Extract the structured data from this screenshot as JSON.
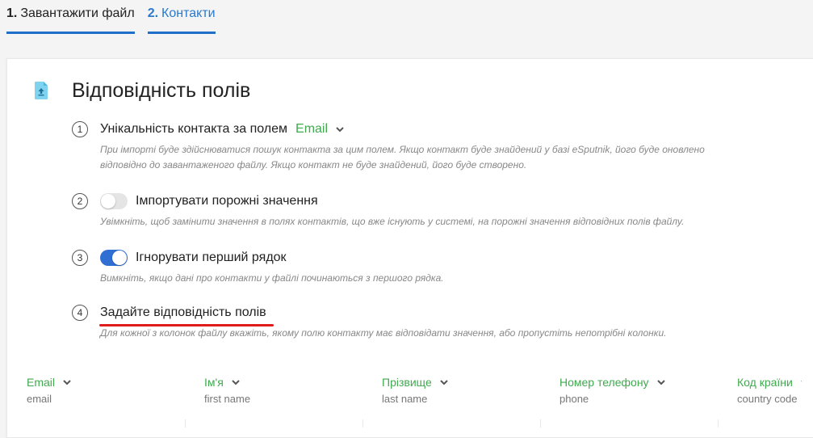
{
  "tabs": [
    {
      "num": "1.",
      "label": "Завантажити файл",
      "active": false
    },
    {
      "num": "2.",
      "label": "Контакти",
      "active": true
    }
  ],
  "card": {
    "title": "Відповідність полів",
    "icon": "document-upload-icon"
  },
  "steps": [
    {
      "num": "1",
      "title": "Унікальність контакта за полем",
      "select_value": "Email",
      "desc": "При імпорті буде здійснюватися пошук контакта за цим полем. Якщо контакт буде знайдений у базі eSputnik, його буде оновлено відповідно до завантаженого файлу. Якщо контакт не буде знайдений, його буде створено."
    },
    {
      "num": "2",
      "title": "Імпортувати порожні значення",
      "toggle_on": false,
      "desc": "Увімкніть, щоб замінити значення в полях контактів, що вже існують у системі, на порожні значення відповідних полів файлу."
    },
    {
      "num": "3",
      "title": "Ігнорувати перший рядок",
      "toggle_on": true,
      "desc": "Вимкніть, якщо дані про контакти у файлі починаються з першого рядка."
    },
    {
      "num": "4",
      "title": "Задайте відповідність полів",
      "desc": "Для кожної з колонок файлу вкажіть, якому полю контакту має відповідати значення, або пропустіть непотрібні колонки."
    }
  ],
  "columns": [
    {
      "field": "Email",
      "sample": "email"
    },
    {
      "field": "Ім'я",
      "sample": "first name"
    },
    {
      "field": "Прізвище",
      "sample": "last name"
    },
    {
      "field": "Номер телефону",
      "sample": "phone"
    },
    {
      "field": "Код країни",
      "sample": "country code"
    }
  ],
  "colors": {
    "accent_blue": "#2979cc",
    "green": "#3faa4e",
    "toggle_on": "#2f6fd3",
    "highlight_red": "#e01b1b"
  }
}
